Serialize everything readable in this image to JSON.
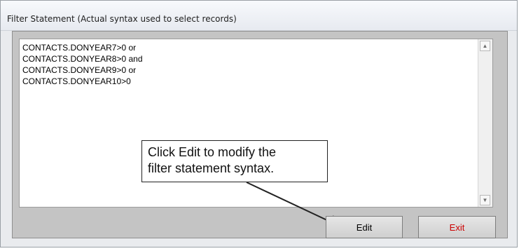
{
  "window": {
    "title": "Filter Statement (Actual syntax used to select records)"
  },
  "filter": {
    "lines": [
      "CONTACTS.DONYEAR7>0 or",
      "CONTACTS.DONYEAR8>0 and",
      "CONTACTS.DONYEAR9>0 or",
      "CONTACTS.DONYEAR10>0"
    ]
  },
  "callout": {
    "line1": "Click Edit to modify the",
    "line2": "filter statement syntax."
  },
  "buttons": {
    "edit_label": "Edit",
    "exit_label": "Exit"
  },
  "colors": {
    "exit_text": "#cc0000",
    "panel_bg": "#c4c4c4"
  },
  "icons": {
    "scroll_up": "scroll-up-arrow-icon",
    "scroll_down": "scroll-down-arrow-icon"
  }
}
